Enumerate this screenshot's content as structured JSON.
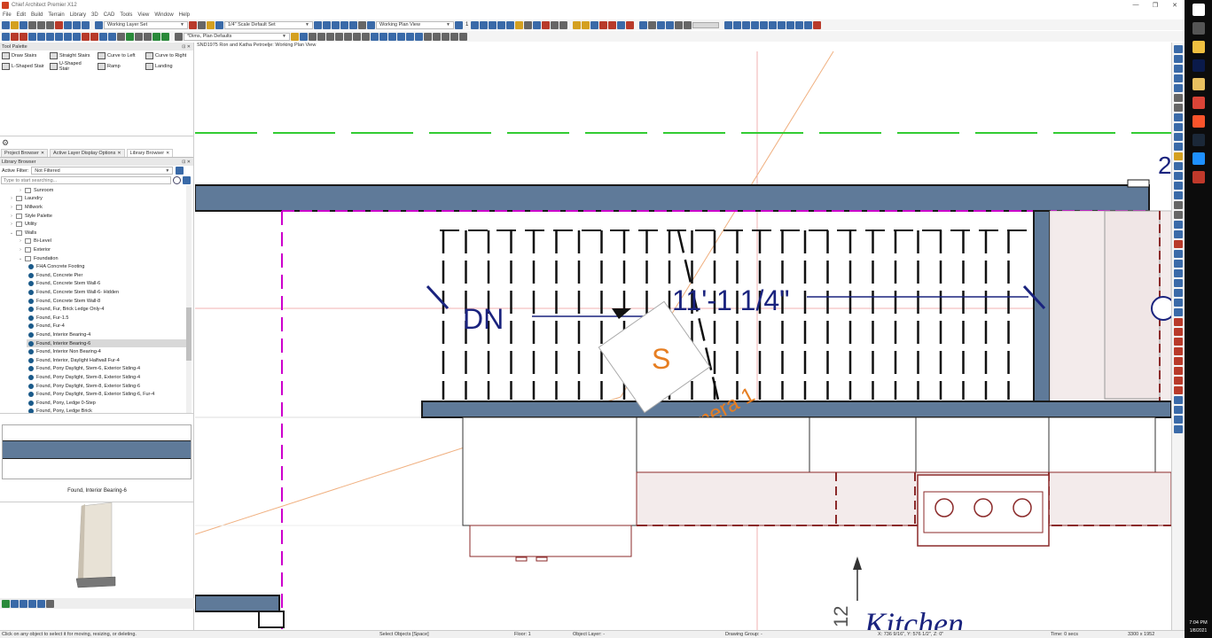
{
  "window": {
    "title": "Chief Architect Premier X12",
    "controls": [
      "—",
      "❐",
      "✕"
    ]
  },
  "menu": [
    "File",
    "Edit",
    "Build",
    "Terrain",
    "Library",
    "3D",
    "CAD",
    "Tools",
    "View",
    "Window",
    "Help"
  ],
  "toolbar": {
    "layer_set": "Working Layer Set",
    "scale_set": "1/4\" Scale Default Set",
    "plan_view": "Working Plan View",
    "floor_number": "1",
    "dims_defaults": "*Dims, Plan Defaults"
  },
  "tool_palette": {
    "title": "Tool Palette",
    "items": [
      {
        "label": "Draw Stairs",
        "icon": "draw-stairs-icon"
      },
      {
        "label": "Straight Stairs",
        "icon": "straight-stairs-icon"
      },
      {
        "label": "Curve to Left",
        "icon": "curve-left-icon"
      },
      {
        "label": "Curve to Right",
        "icon": "curve-right-icon"
      },
      {
        "label": "L-Shaped Stair",
        "icon": "l-stair-icon"
      },
      {
        "label": "U-Shaped Stair",
        "icon": "u-stair-icon"
      },
      {
        "label": "Ramp",
        "icon": "ramp-icon"
      },
      {
        "label": "Landing",
        "icon": "landing-icon"
      }
    ]
  },
  "panel_tabs": [
    {
      "label": "Project Browser",
      "active": false
    },
    {
      "label": "Active Layer Display Options",
      "active": false
    },
    {
      "label": "Library Browser",
      "active": true
    }
  ],
  "library": {
    "title": "Library Browser",
    "filter_label": "Active Filter:",
    "filter_value": "Not Filtered",
    "search_placeholder": "Type to start searching...",
    "tree": [
      {
        "label": "Sunroom",
        "type": "folder",
        "level": 2,
        "expanded": false
      },
      {
        "label": "Laundry",
        "type": "folder",
        "level": 1,
        "expanded": false
      },
      {
        "label": "Millwork",
        "type": "folder",
        "level": 1,
        "expanded": false
      },
      {
        "label": "Style Palette",
        "type": "folder",
        "level": 1,
        "expanded": false
      },
      {
        "label": "Utility",
        "type": "folder",
        "level": 1,
        "expanded": false
      },
      {
        "label": "Walls",
        "type": "folder",
        "level": 1,
        "expanded": true
      },
      {
        "label": "Bi-Level",
        "type": "folder",
        "level": 2,
        "expanded": false
      },
      {
        "label": "Exterior",
        "type": "folder",
        "level": 2,
        "expanded": false
      },
      {
        "label": "Foundation",
        "type": "folder",
        "level": 2,
        "expanded": true
      },
      {
        "label": "FHA Concrete Footing",
        "type": "item",
        "level": 3
      },
      {
        "label": "Found, Concrete Pier",
        "type": "item",
        "level": 3
      },
      {
        "label": "Found, Concrete Stem Wall-6",
        "type": "item",
        "level": 3
      },
      {
        "label": "Found, Concrete Stem Wall-6- Hidden",
        "type": "item",
        "level": 3
      },
      {
        "label": "Found, Concrete Stem Wall-8",
        "type": "item",
        "level": 3
      },
      {
        "label": "Found, Fur, Brick Ledge Only-4",
        "type": "item",
        "level": 3
      },
      {
        "label": "Found, Fur-1.5",
        "type": "item",
        "level": 3
      },
      {
        "label": "Found, Fur-4",
        "type": "item",
        "level": 3
      },
      {
        "label": "Found, Interior Bearing-4",
        "type": "item",
        "level": 3
      },
      {
        "label": "Found, Interior Bearing-6",
        "type": "item",
        "level": 3,
        "selected": true
      },
      {
        "label": "Found, Interior Non Bearing-4",
        "type": "item",
        "level": 3
      },
      {
        "label": "Found, Interior, Daylight Halfwall Fur-4",
        "type": "item",
        "level": 3
      },
      {
        "label": "Found, Pony Daylight, Stem-6, Exterior Siding-4",
        "type": "item",
        "level": 3
      },
      {
        "label": "Found, Pony Daylight, Stem-8, Exterior Siding-4",
        "type": "item",
        "level": 3
      },
      {
        "label": "Found, Pony Daylight, Stem-8, Exterior Siding-6",
        "type": "item",
        "level": 3
      },
      {
        "label": "Found, Pony Daylight, Stem-8, Exterior Siding-6, Fur-4",
        "type": "item",
        "level": 3
      },
      {
        "label": "Found, Pony, Ledge 0-Step",
        "type": "item",
        "level": 3
      },
      {
        "label": "Found, Pony, Ledge Brick",
        "type": "item",
        "level": 3
      }
    ],
    "preview_caption": "Found, Interior Bearing-6"
  },
  "canvas": {
    "tab_title": "SND1975 Ron and Katha Petroelje:  Working Plan View",
    "labels": {
      "dn": "DN",
      "dimension": "11'-1 1/4\"",
      "camera_marker": "S",
      "camera_name": "Camera 1",
      "room_name": "Kitchen",
      "room_dim": "12",
      "edge_number": "2"
    }
  },
  "statusbar": {
    "hint": "Click on any object to select it for moving, resizing, or deleting.",
    "mode": "Select Objects [Space]",
    "floor": "Floor: 1",
    "object_layer": "Object Layer: -",
    "drawing_group": "Drawing Group: -",
    "coords": "X: 736 9/16\", Y: 576 1/2\", Z: 0\"",
    "time": "Time: 0 secs",
    "resolution": "3300 x 1952"
  },
  "taskbar": {
    "time": "7:04 PM",
    "date": "1/8/2021",
    "apps": [
      {
        "icon": "windows-start-icon",
        "color": "#ffffff"
      },
      {
        "icon": "app-icon",
        "color": "#555555"
      },
      {
        "icon": "file-explorer-icon",
        "color": "#f0c040"
      },
      {
        "icon": "photoshop-icon",
        "color": "#0a1a4a"
      },
      {
        "icon": "folder-icon",
        "color": "#e8c060"
      },
      {
        "icon": "chrome-icon",
        "color": "#db4437"
      },
      {
        "icon": "brave-icon",
        "color": "#fb542b"
      },
      {
        "icon": "steam-icon",
        "color": "#1b2838"
      },
      {
        "icon": "app-blue-icon",
        "color": "#1e90ff"
      },
      {
        "icon": "app-red-icon",
        "color": "#c0392b"
      }
    ]
  },
  "colors": {
    "wall_fill": "#5f7a99",
    "dimension_text": "#1a237e",
    "camera": "#e67e22",
    "layer_line": "#cc00cc",
    "green_dash": "#33cc33",
    "cabinet": "#8b2a2a"
  }
}
